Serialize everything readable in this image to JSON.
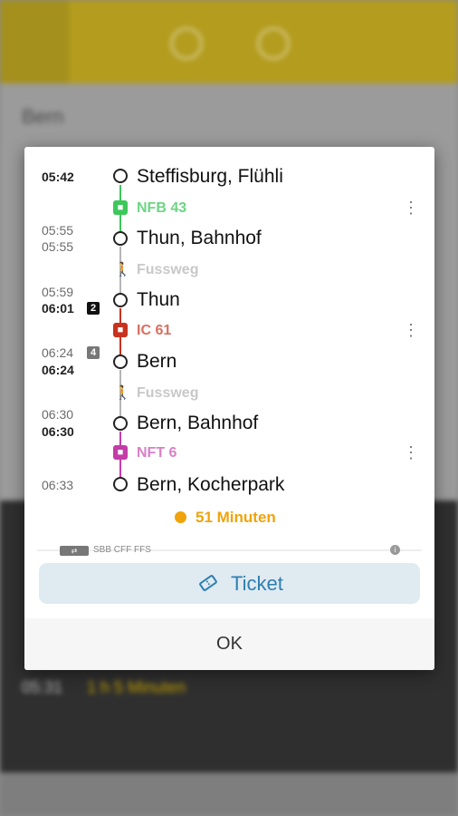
{
  "background": {
    "title": "Bern",
    "dark_duration": "1 h 5 Minuten",
    "dark_time": "05:31"
  },
  "stops": [
    {
      "arr": "",
      "dep": "05:42",
      "name": "Steffisburg, Flühli",
      "platform": ""
    },
    {
      "arr": "05:55",
      "dep": "05:55",
      "name": "Thun, Bahnhof",
      "platform": ""
    },
    {
      "arr": "05:59",
      "dep": "06:01",
      "name": "Thun",
      "platform": "2"
    },
    {
      "arr": "06:24",
      "dep": "06:24",
      "name": "Bern",
      "platform": "4"
    },
    {
      "arr": "06:30",
      "dep": "06:30",
      "name": "Bern, Bahnhof",
      "platform": ""
    },
    {
      "arr": "06:33",
      "dep": "",
      "name": "Bern, Kocherpark",
      "platform": ""
    }
  ],
  "legs": [
    {
      "label": "NFB 43",
      "color": "#3cc85a",
      "icon": "bus-icon"
    },
    {
      "label": "Fussweg",
      "color": "#b5b5b5",
      "icon": "walk-icon"
    },
    {
      "label": "IC 61",
      "color": "#c8321e",
      "icon": "train-icon"
    },
    {
      "label": "Fussweg",
      "color": "#b5b5b5",
      "icon": "walk-icon"
    },
    {
      "label": "NFT 6",
      "color": "#c43ca8",
      "icon": "tram-icon"
    }
  ],
  "duration": "51 Minuten",
  "provider": "SBB CFF FFS",
  "ticket_label": "Ticket",
  "ok_label": "OK",
  "colors": {
    "accent": "#f0a30a",
    "ticket_text": "#2f7fb0",
    "ticket_bg": "#dfeaf1"
  }
}
